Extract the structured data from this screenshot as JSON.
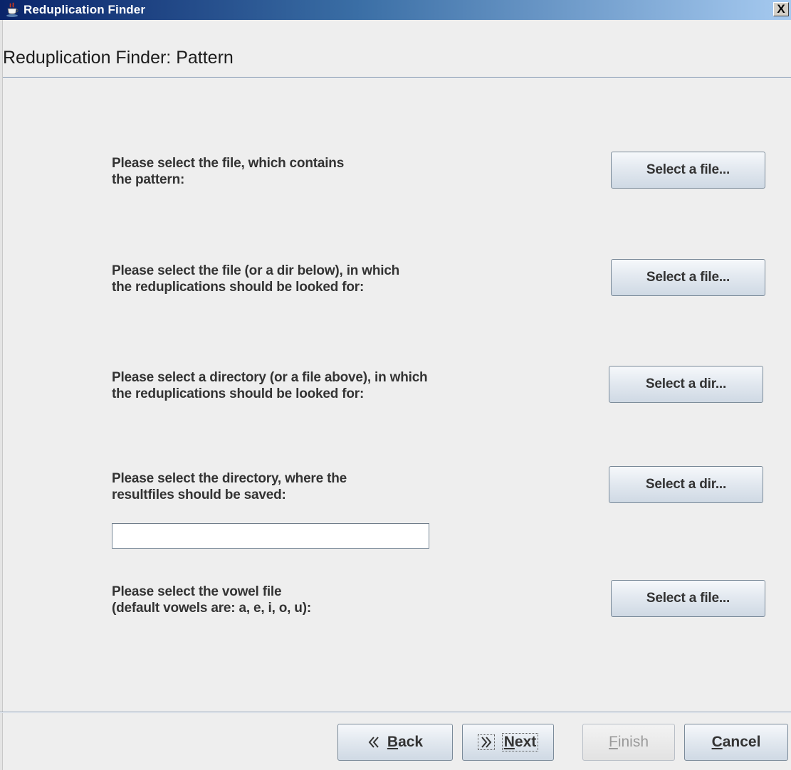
{
  "window": {
    "title": "Reduplication Finder",
    "close_glyph": "X",
    "icon": "java-cup-icon"
  },
  "header": {
    "title": "Reduplication Finder: Pattern"
  },
  "rows": [
    {
      "line1": "Please select the file, which contains",
      "line2": "the pattern:",
      "button_label": "Select a file..."
    },
    {
      "line1": "Please select the file (or a dir below), in which",
      "line2": "the reduplications should be looked for:",
      "button_label": "Select a file..."
    },
    {
      "line1": "Please select a directory (or a file above), in which",
      "line2": "the reduplications should be looked for:",
      "button_label": "Select a dir..."
    },
    {
      "line1": "Please select the directory, where the",
      "line2": "resultfiles should be saved:",
      "button_label": "Select a dir..."
    },
    {
      "line1": "Please select the vowel file",
      "line2": "(default vowels are: a, e, i, o, u):",
      "button_label": "Select a file..."
    }
  ],
  "result_dir_field": {
    "value": "",
    "placeholder": ""
  },
  "wizard": {
    "back": {
      "mnemonic": "B",
      "rest": "ack",
      "icon": "double-chevron-left-icon"
    },
    "next": {
      "mnemonic": "N",
      "rest": "ext",
      "icon": "double-chevron-right-icon"
    },
    "finish": {
      "mnemonic": "F",
      "rest": "inish",
      "enabled": false
    },
    "cancel": {
      "mnemonic": "C",
      "rest": "ancel"
    }
  },
  "colors": {
    "titlebar_start": "#0a246a",
    "titlebar_end": "#a6caf0",
    "background": "#eeeeee",
    "separator": "#7a8ea8"
  }
}
